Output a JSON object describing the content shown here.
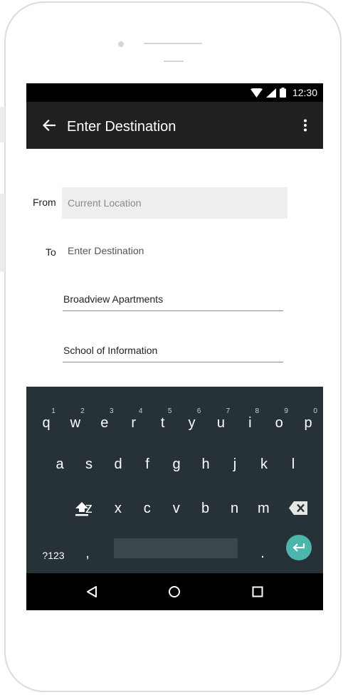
{
  "status_bar": {
    "time": "12:30",
    "icons": [
      "wifi-icon",
      "signal-icon",
      "battery-icon"
    ]
  },
  "app_bar": {
    "title": "Enter Destination",
    "back_icon": "arrow-back-icon",
    "menu_icon": "more-vert-icon"
  },
  "form": {
    "from_label": "From",
    "from_placeholder": "Current Location",
    "to_label": "To",
    "to_placeholder": "Enter Destination"
  },
  "suggestions": [
    "Broadview Apartments",
    "School of Information"
  ],
  "keyboard": {
    "row1": [
      {
        "key": "q",
        "num": "1"
      },
      {
        "key": "w",
        "num": "2"
      },
      {
        "key": "e",
        "num": "3"
      },
      {
        "key": "r",
        "num": "4"
      },
      {
        "key": "t",
        "num": "5"
      },
      {
        "key": "y",
        "num": "6"
      },
      {
        "key": "u",
        "num": "7"
      },
      {
        "key": "i",
        "num": "8"
      },
      {
        "key": "o",
        "num": "9"
      },
      {
        "key": "p",
        "num": "0"
      }
    ],
    "row2": [
      "a",
      "s",
      "d",
      "f",
      "g",
      "h",
      "j",
      "k",
      "l"
    ],
    "row3": [
      "z",
      "x",
      "c",
      "v",
      "b",
      "n",
      "m"
    ],
    "symbols_label": "?123",
    "comma": ",",
    "period": ".",
    "shift_icon": "shift-icon",
    "backspace_icon": "backspace-icon",
    "enter_icon": "enter-icon",
    "enter_color": "#4db6ac",
    "background_color": "#263238"
  },
  "nav_bar": {
    "icons": [
      "back-triangle-icon",
      "home-circle-icon",
      "recents-square-icon"
    ]
  },
  "colors": {
    "app_bar": "#212121",
    "status_bar": "#000000",
    "input_fill": "#eeeeee"
  }
}
